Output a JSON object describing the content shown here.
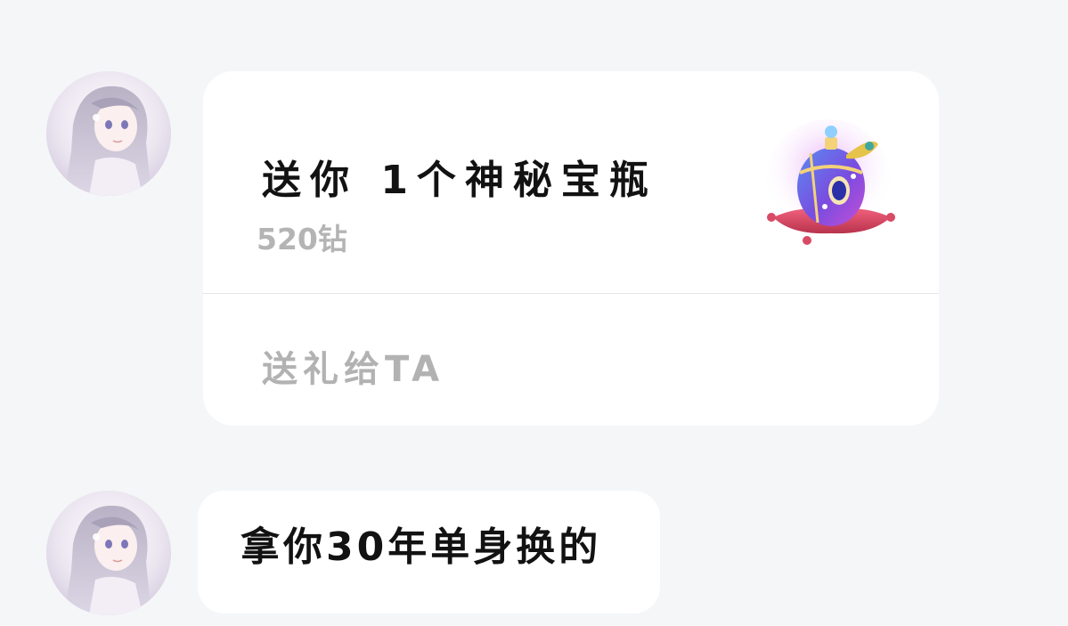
{
  "messages": [
    {
      "type": "gift",
      "avatar_icon": "anime-girl-avatar",
      "gift_title": "送你 1个神秘宝瓶",
      "gift_price": "520钻",
      "gift_icon": "mystery-bottle-icon",
      "action_label": "送礼给TA"
    },
    {
      "type": "text",
      "avatar_icon": "anime-girl-avatar",
      "text": "拿你30年单身换的"
    }
  ],
  "colors": {
    "background": "#f5f6f8",
    "bubble": "#ffffff",
    "primary_text": "#121212",
    "secondary_text": "#b4b4b4",
    "divider": "#e6e6e6"
  }
}
